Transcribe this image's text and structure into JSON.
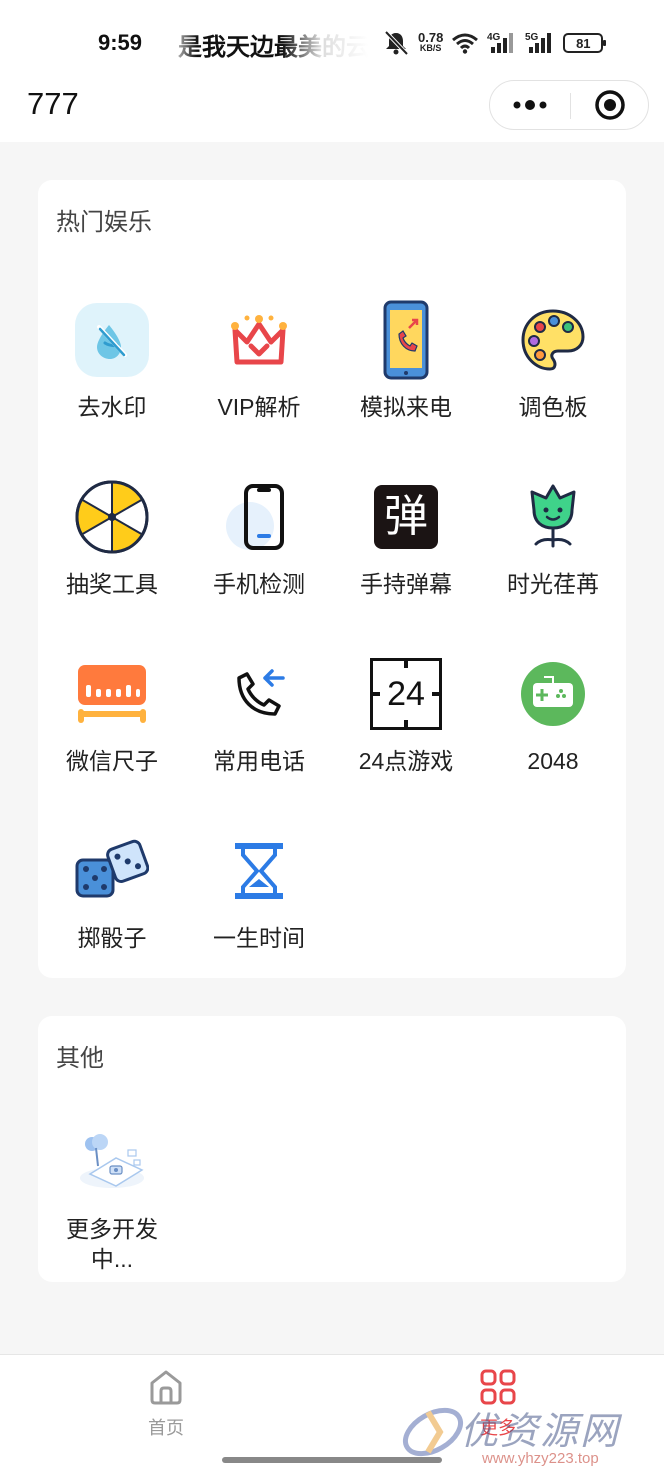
{
  "status_bar": {
    "time": "9:59",
    "marquee": "是我天边最美的云",
    "net_speed": "0.78",
    "net_unit": "KB/S",
    "sig1": "4G",
    "sig2": "5G",
    "battery": "81"
  },
  "nav": {
    "title": "777"
  },
  "hot": {
    "title": "热门娱乐",
    "items": [
      {
        "label": "去水印",
        "icon": "watermark-remove-icon"
      },
      {
        "label": "VIP解析",
        "icon": "vip-crown-icon"
      },
      {
        "label": "模拟来电",
        "icon": "fake-call-phone-icon"
      },
      {
        "label": "调色板",
        "icon": "palette-icon"
      },
      {
        "label": "抽奖工具",
        "icon": "lottery-wheel-icon"
      },
      {
        "label": "手机检测",
        "icon": "phone-check-icon"
      },
      {
        "label": "手持弹幕",
        "icon": "danmaku-icon"
      },
      {
        "label": "时光荏苒",
        "icon": "time-plant-icon"
      },
      {
        "label": "微信尺子",
        "icon": "ruler-icon"
      },
      {
        "label": "常用电话",
        "icon": "phone-call-icon"
      },
      {
        "label": "24点游戏",
        "icon": "game-24-icon"
      },
      {
        "label": "2048",
        "icon": "gamepad-icon"
      },
      {
        "label": "掷骰子",
        "icon": "dice-icon"
      },
      {
        "label": "一生时间",
        "icon": "hourglass-icon"
      }
    ],
    "danmaku_char": "弹",
    "game24_text": "24"
  },
  "other": {
    "title": "其他",
    "items": [
      {
        "label_line1": "更多开发",
        "label_line2": "中...",
        "icon": "developing-illustration-icon"
      }
    ]
  },
  "tabbar": {
    "tabs": [
      {
        "label": "首页",
        "icon": "home-icon",
        "active": false
      },
      {
        "label": "更多",
        "icon": "grid-icon",
        "active": true
      }
    ],
    "active_color": "#e8464a",
    "inactive_color": "#9a9a9a"
  },
  "watermark": {
    "text": "优资源网",
    "url": "www.yhzy223.top"
  }
}
